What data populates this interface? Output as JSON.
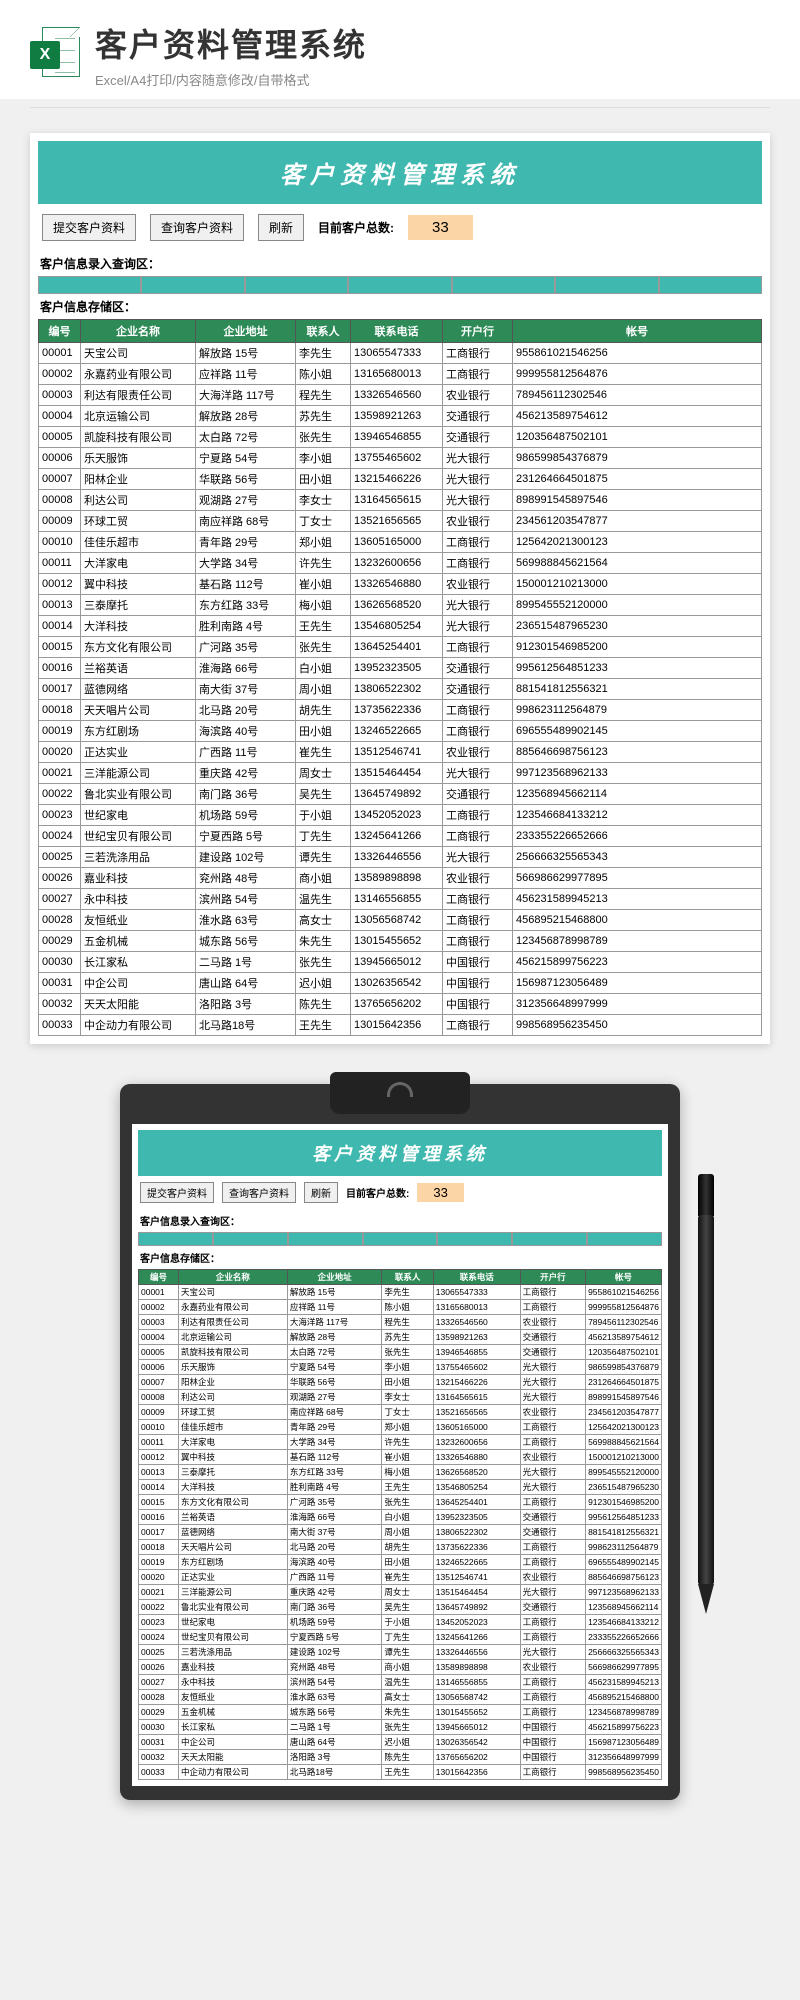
{
  "header": {
    "icon_letter": "X",
    "title": "客户资料管理系统",
    "subtitle": "Excel/A4打印/内容随意修改/自带格式"
  },
  "sheet": {
    "banner": "客户资料管理系统",
    "buttons": {
      "submit": "提交客户资料",
      "query": "查询客户资料",
      "refresh": "刷新"
    },
    "count_label": "目前客户总数:",
    "count_value": "33",
    "query_section": "客户信息录入查询区：",
    "storage_section": "客户信息存储区：",
    "columns": [
      "编号",
      "企业名称",
      "企业地址",
      "联系人",
      "联系电话",
      "开户行",
      "帐号"
    ],
    "rows": [
      [
        "00001",
        "天宝公司",
        "解放路 15号",
        "李先生",
        "13065547333",
        "工商银行",
        "955861021546256"
      ],
      [
        "00002",
        "永嘉药业有限公司",
        "应祥路 11号",
        "陈小姐",
        "13165680013",
        "工商银行",
        "999955812564876"
      ],
      [
        "00003",
        "利达有限责任公司",
        "大海洋路 117号",
        "程先生",
        "13326546560",
        "农业银行",
        "789456112302546"
      ],
      [
        "00004",
        "北京运输公司",
        "解放路 28号",
        "苏先生",
        "13598921263",
        "交通银行",
        "456213589754612"
      ],
      [
        "00005",
        "凯旋科技有限公司",
        "太白路 72号",
        "张先生",
        "13946546855",
        "交通银行",
        "120356487502101"
      ],
      [
        "00006",
        "乐天服饰",
        "宁夏路 54号",
        "李小姐",
        "13755465602",
        "光大银行",
        "986599854376879"
      ],
      [
        "00007",
        "阳林企业",
        "华联路 56号",
        "田小姐",
        "13215466226",
        "光大银行",
        "231264664501875"
      ],
      [
        "00008",
        "利达公司",
        "观湖路 27号",
        "李女士",
        "13164565615",
        "光大银行",
        "898991545897546"
      ],
      [
        "00009",
        "环球工贸",
        "南应祥路 68号",
        "丁女士",
        "13521656565",
        "农业银行",
        "234561203547877"
      ],
      [
        "00010",
        "佳佳乐超市",
        "青年路 29号",
        "郑小姐",
        "13605165000",
        "工商银行",
        "125642021300123"
      ],
      [
        "00011",
        "大洋家电",
        "大学路 34号",
        "许先生",
        "13232600656",
        "工商银行",
        "569988845621564"
      ],
      [
        "00012",
        "翼中科技",
        "基石路 112号",
        "崔小姐",
        "13326546880",
        "农业银行",
        "150001210213000"
      ],
      [
        "00013",
        "三泰摩托",
        "东方红路 33号",
        "梅小姐",
        "13626568520",
        "光大银行",
        "899545552120000"
      ],
      [
        "00014",
        "大洋科技",
        "胜利南路 4号",
        "王先生",
        "13546805254",
        "光大银行",
        "236515487965230"
      ],
      [
        "00015",
        "东方文化有限公司",
        "广河路 35号",
        "张先生",
        "13645254401",
        "工商银行",
        "912301546985200"
      ],
      [
        "00016",
        "兰裕英语",
        "淮海路 66号",
        "白小姐",
        "13952323505",
        "交通银行",
        "995612564851233"
      ],
      [
        "00017",
        "蓝德网络",
        "南大街 37号",
        "周小姐",
        "13806522302",
        "交通银行",
        "881541812556321"
      ],
      [
        "00018",
        "天天唱片公司",
        "北马路 20号",
        "胡先生",
        "13735622336",
        "工商银行",
        "998623112564879"
      ],
      [
        "00019",
        "东方红剧场",
        "海滨路 40号",
        "田小姐",
        "13246522665",
        "工商银行",
        "696555489902145"
      ],
      [
        "00020",
        "正达实业",
        "广西路 11号",
        "崔先生",
        "13512546741",
        "农业银行",
        "885646698756123"
      ],
      [
        "00021",
        "三洋能源公司",
        "重庆路 42号",
        "周女士",
        "13515464454",
        "光大银行",
        "997123568962133"
      ],
      [
        "00022",
        "鲁北实业有限公司",
        "南门路 36号",
        "吴先生",
        "13645749892",
        "交通银行",
        "123568945662114"
      ],
      [
        "00023",
        "世纪家电",
        "机场路 59号",
        "于小姐",
        "13452052023",
        "工商银行",
        "123546684133212"
      ],
      [
        "00024",
        "世纪宝贝有限公司",
        "宁夏西路 5号",
        "丁先生",
        "13245641266",
        "工商银行",
        "233355226652666"
      ],
      [
        "00025",
        "三若洗涤用品",
        "建设路 102号",
        "谭先生",
        "13326446556",
        "光大银行",
        "256666325565343"
      ],
      [
        "00026",
        "嘉业科技",
        "兖州路 48号",
        "商小姐",
        "13589898898",
        "农业银行",
        "566986629977895"
      ],
      [
        "00027",
        "永中科技",
        "滨州路 54号",
        "温先生",
        "13146556855",
        "工商银行",
        "456231589945213"
      ],
      [
        "00028",
        "友恒纸业",
        "淮水路 63号",
        "高女士",
        "13056568742",
        "工商银行",
        "456895215468800"
      ],
      [
        "00029",
        "五金机械",
        "城东路 56号",
        "朱先生",
        "13015455652",
        "工商银行",
        "123456878998789"
      ],
      [
        "00030",
        "长江家私",
        "二马路 1号",
        "张先生",
        "13945665012",
        "中国银行",
        "456215899756223"
      ],
      [
        "00031",
        "中企公司",
        "唐山路 64号",
        "迟小姐",
        "13026356542",
        "中国银行",
        "156987123056489"
      ],
      [
        "00032",
        "天天太阳能",
        "洛阳路 3号",
        "陈先生",
        "13765656202",
        "中国银行",
        "312356648997999"
      ],
      [
        "00033",
        "中企动力有限公司",
        "北马路18号",
        "王先生",
        "13015642356",
        "工商银行",
        "998568956235450"
      ]
    ]
  }
}
